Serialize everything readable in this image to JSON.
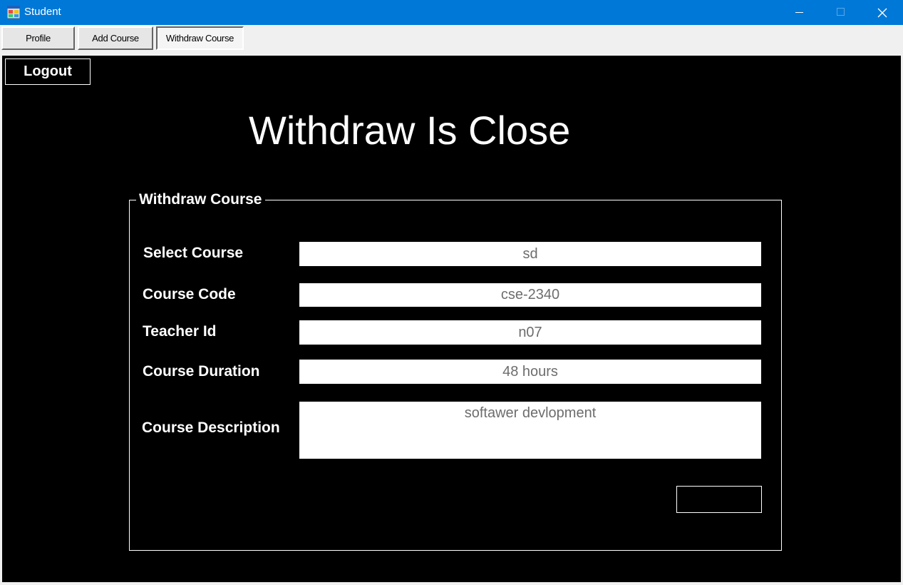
{
  "window": {
    "title": "Student",
    "icon": "windows-form-icon",
    "controls": [
      "minimize-icon",
      "maximize-icon",
      "close-icon"
    ],
    "title_bar_color": "#0078d7"
  },
  "tabs": [
    {
      "label": "Profile",
      "active": false
    },
    {
      "label": "Add Course",
      "active": false
    },
    {
      "label": "Withdraw Course",
      "active": true
    }
  ],
  "main": {
    "logout_label": "Logout",
    "heading": "Withdraw Is Close",
    "group": {
      "legend": "Withdraw Course",
      "fields": [
        {
          "label": "Select Course",
          "value": "sd"
        },
        {
          "label": "Course Code",
          "value": "cse-2340"
        },
        {
          "label": "Teacher Id",
          "value": "n07"
        },
        {
          "label": "Course Duration",
          "value": "48 hours"
        },
        {
          "label": "Course Description",
          "value": "softawer devlopment"
        }
      ],
      "action_label": ""
    }
  }
}
